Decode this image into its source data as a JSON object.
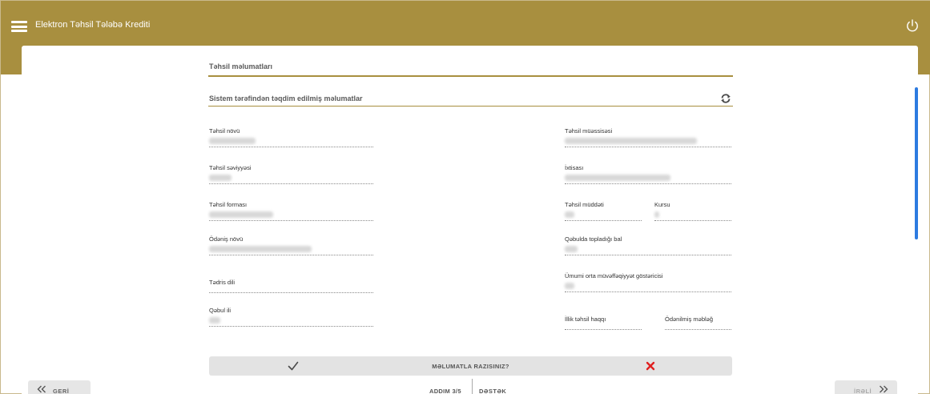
{
  "header": {
    "app_title": "Elektron Təhsil Tələbə Krediti"
  },
  "section": {
    "title": "Təhsil məlumatları",
    "subtitle": "Sistem tərəfindən təqdim edilmiş məlumatlar"
  },
  "fields": {
    "education_type": {
      "label": "Təhsil növü"
    },
    "institution": {
      "label": "Təhsil müəssisəsi"
    },
    "education_level": {
      "label": "Təhsil səviyyəsi"
    },
    "specialty": {
      "label": "İxtisası"
    },
    "education_form": {
      "label": "Təhsil forması"
    },
    "education_duration": {
      "label": "Təhsil müddəti"
    },
    "course": {
      "label": "Kursu"
    },
    "payment_type": {
      "label": "Ödəniş növü"
    },
    "admission_score": {
      "label": "Qəbulda topladığı bal"
    },
    "teaching_language": {
      "label": "Tədris dili"
    },
    "gpa_indicator": {
      "label": "Ümumi orta müvəffəqiyyət göstəricisi"
    },
    "admission_year": {
      "label": "Qəbul ili"
    },
    "annual_fee": {
      "label": "İllik təhsil haqqı"
    },
    "paid_amount": {
      "label": "Ödənilmiş məbləğ"
    }
  },
  "confirm": {
    "question": "MƏLUMATLA RAZISINIZ?"
  },
  "footer": {
    "back_label": "GERİ",
    "next_label": "İRƏLİ",
    "step_label": "ADDIM 3/5",
    "support_label": "DƏSTƏK"
  },
  "colors": {
    "brand": "#a88f3f",
    "confirm_yes": "#4a4a4a",
    "confirm_no": "#e02020",
    "scrollbar": "#2d7be0"
  },
  "icons": {
    "menu": "hamburger-icon",
    "power": "power-icon",
    "refresh": "refresh-icon",
    "yes": "checkmark-icon",
    "no": "close-icon",
    "back": "double-chevron-left-icon",
    "next": "double-chevron-right-icon"
  }
}
